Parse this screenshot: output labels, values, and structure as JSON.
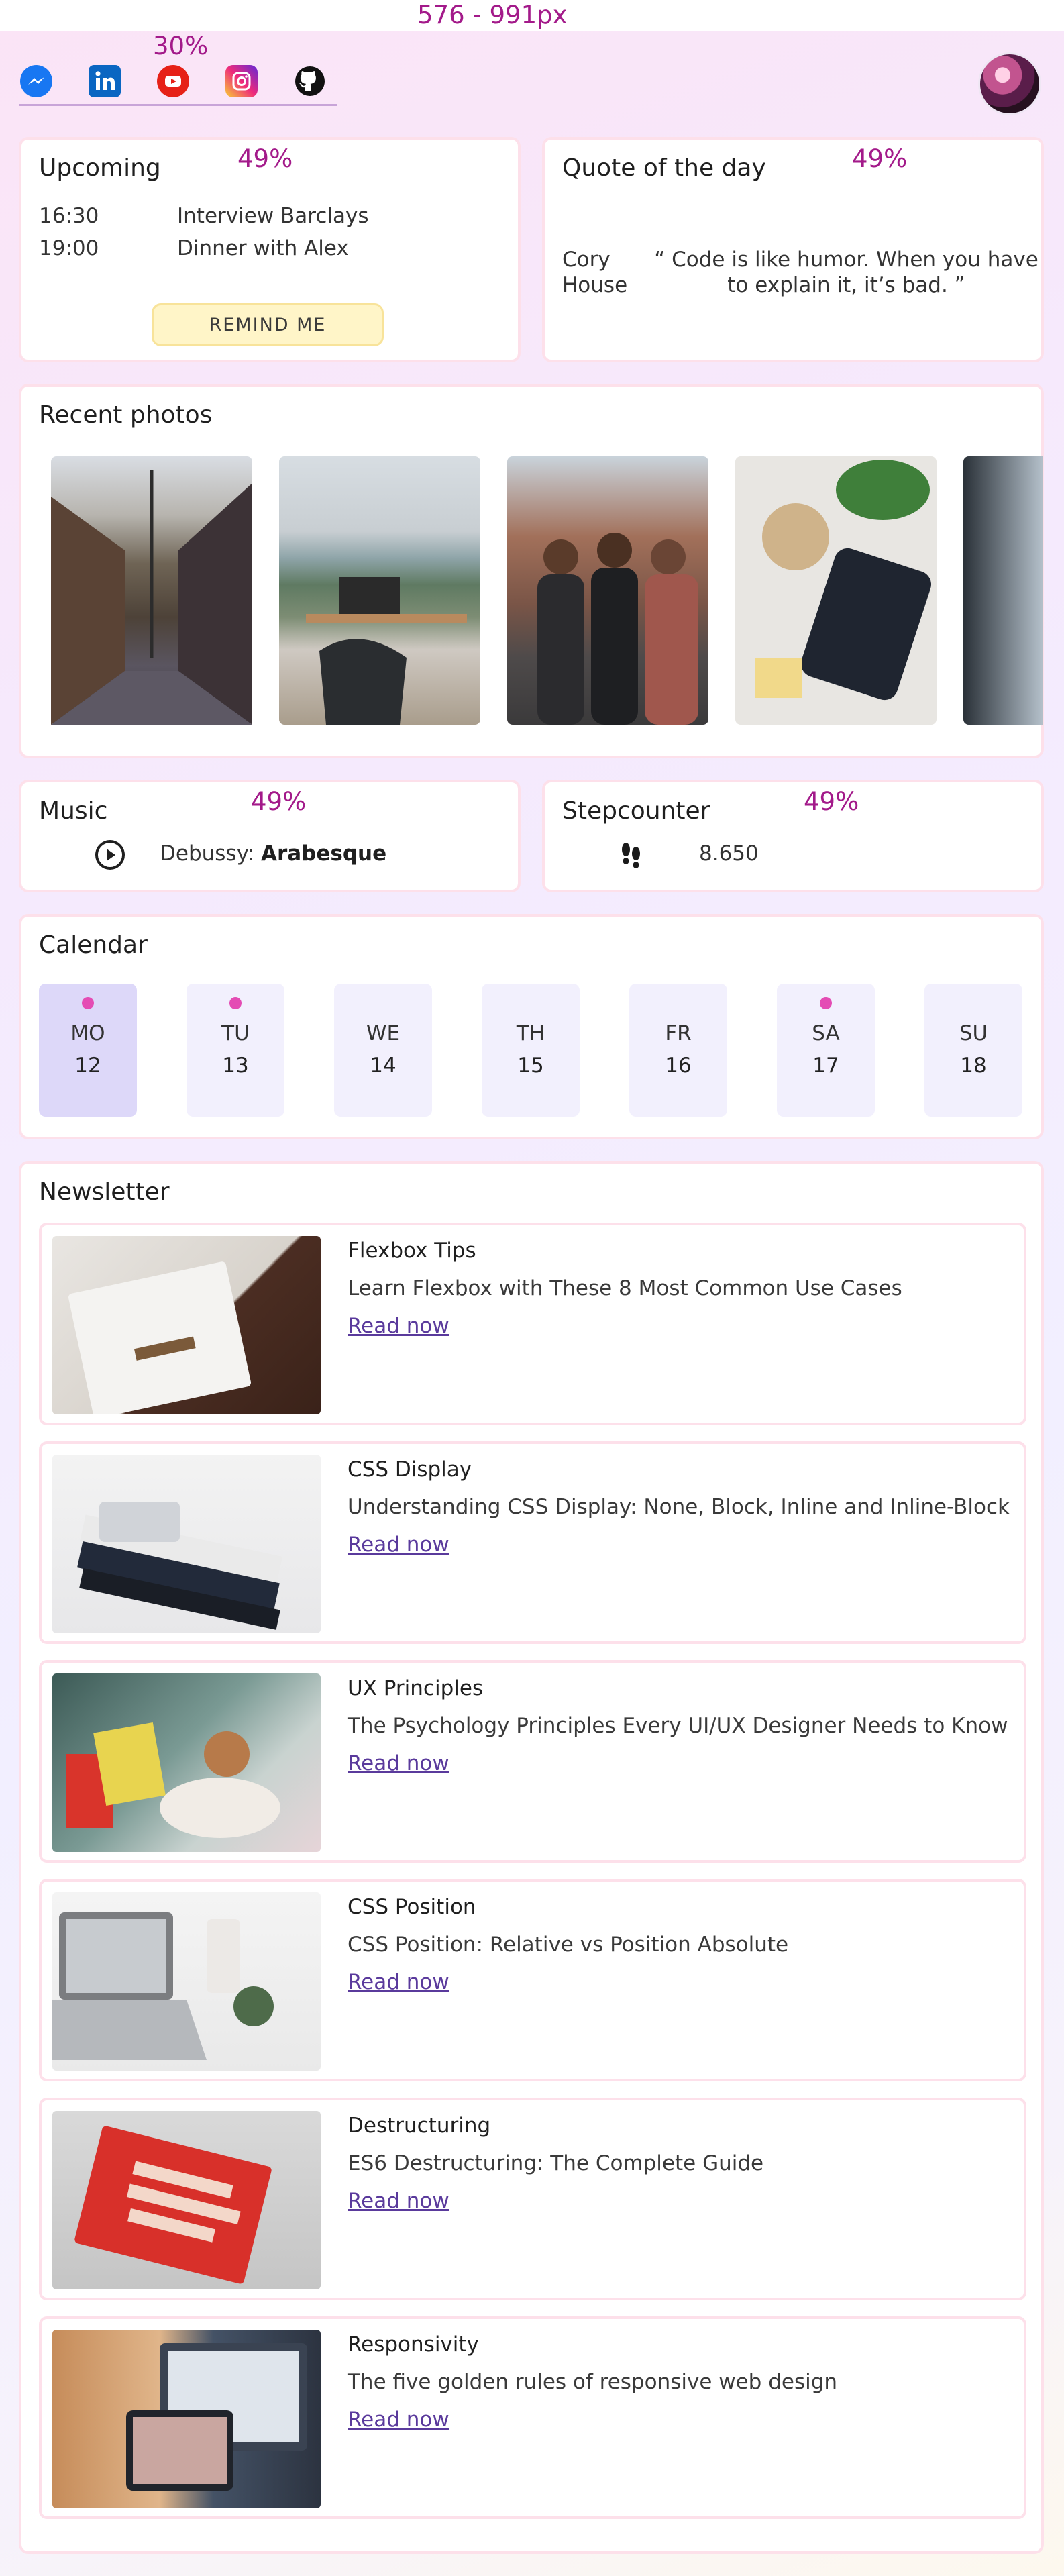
{
  "header": {
    "width_label": "576 - 991px",
    "social_width_label": "30%",
    "social": [
      {
        "icon": "messenger-icon",
        "color": "#1877f2"
      },
      {
        "icon": "linkedin-icon",
        "color": "#0a66c2"
      },
      {
        "icon": "youtube-icon",
        "color": "#e62117"
      },
      {
        "icon": "instagram-icon",
        "color": "#e1306c"
      },
      {
        "icon": "github-icon",
        "color": "#111111"
      }
    ],
    "avatar": "avatar"
  },
  "upcoming": {
    "title": "Upcoming",
    "width_label": "49%",
    "events": [
      {
        "time": "16:30",
        "event": "Interview Barclays"
      },
      {
        "time": "19:00",
        "event": "Dinner with Alex"
      }
    ],
    "button": "REMIND ME"
  },
  "quote": {
    "title": "Quote of the day",
    "width_label": "49%",
    "author": "Cory House",
    "text": "“ Code is like humor. When you have to explain it, it’s bad. ”"
  },
  "photos": {
    "title": "Recent photos"
  },
  "music": {
    "title": "Music",
    "width_label": "49%",
    "composer": "Debussy:",
    "piece": "Arabesque"
  },
  "steps": {
    "title": "Stepcounter",
    "width_label": "49%",
    "count": "8.650"
  },
  "calendar": {
    "title": "Calendar",
    "days": [
      {
        "name": "MO",
        "num": "12",
        "event": true,
        "active": true
      },
      {
        "name": "TU",
        "num": "13",
        "event": true,
        "active": false
      },
      {
        "name": "WE",
        "num": "14",
        "event": false,
        "active": false
      },
      {
        "name": "TH",
        "num": "15",
        "event": false,
        "active": false
      },
      {
        "name": "FR",
        "num": "16",
        "event": false,
        "active": false
      },
      {
        "name": "SA",
        "num": "17",
        "event": true,
        "active": false
      },
      {
        "name": "SU",
        "num": "18",
        "event": false,
        "active": false
      }
    ]
  },
  "newsletter": {
    "title": "Newsletter",
    "items": [
      {
        "title": "Flexbox Tips",
        "desc": "Learn Flexbox with These 8 Most Common Use Cases",
        "link": "Read now"
      },
      {
        "title": "CSS Display",
        "desc": "Understanding CSS Display: None, Block, Inline and Inline-Block",
        "link": "Read now"
      },
      {
        "title": "UX Principles",
        "desc": "The Psychology Principles Every UI/UX Designer Needs to Know",
        "link": "Read now"
      },
      {
        "title": "CSS Position",
        "desc": "CSS Position: Relative vs Position Absolute",
        "link": "Read now"
      },
      {
        "title": "Destructuring",
        "desc": "ES6 Destructuring: The Complete Guide",
        "link": "Read now"
      },
      {
        "title": "Responsivity",
        "desc": "The five golden rules of responsive web design",
        "link": "Read now"
      }
    ]
  }
}
